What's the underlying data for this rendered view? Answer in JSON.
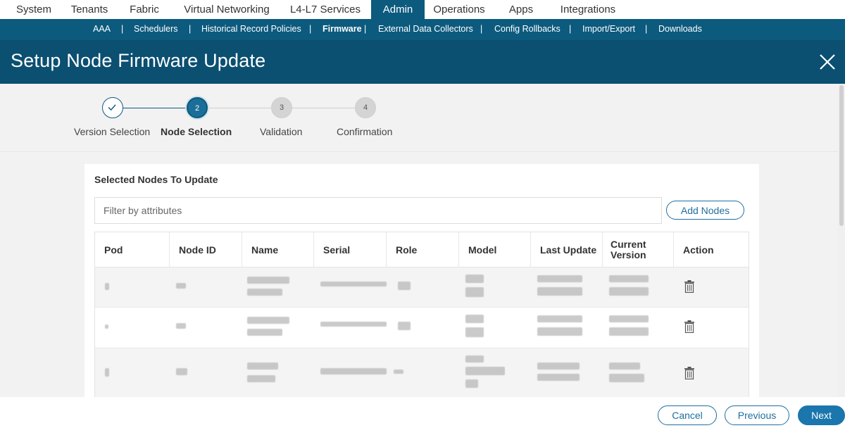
{
  "topnav": {
    "tabs": [
      {
        "label": "System"
      },
      {
        "label": "Tenants"
      },
      {
        "label": "Fabric"
      },
      {
        "label": "Virtual Networking"
      },
      {
        "label": "L4-L7 Services"
      },
      {
        "label": "Admin",
        "active": true
      },
      {
        "label": "Operations"
      },
      {
        "label": "Apps"
      },
      {
        "label": "Integrations"
      }
    ]
  },
  "subnav": {
    "items": [
      {
        "label": "AAA"
      },
      {
        "label": "Schedulers"
      },
      {
        "label": "Historical Record Policies"
      },
      {
        "label": "Firmware",
        "active": true
      },
      {
        "label": "External Data Collectors"
      },
      {
        "label": "Config Rollbacks"
      },
      {
        "label": "Import/Export"
      },
      {
        "label": "Downloads"
      }
    ],
    "separator": "|"
  },
  "header": {
    "title": "Setup Node Firmware Update",
    "close_icon": "close-icon"
  },
  "wizard": {
    "steps": [
      {
        "number": "",
        "label": "Version Selection",
        "state": "done",
        "icon": "check-icon"
      },
      {
        "number": "2",
        "label": "Node Selection",
        "state": "current"
      },
      {
        "number": "3",
        "label": "Validation",
        "state": "todo"
      },
      {
        "number": "4",
        "label": "Confirmation",
        "state": "todo"
      }
    ]
  },
  "main": {
    "section_title": "Selected Nodes To Update",
    "filter_placeholder": "Filter by attributes",
    "add_nodes_label": "Add Nodes",
    "table": {
      "columns": [
        "Pod",
        "Node ID",
        "Name",
        "Serial",
        "Role",
        "Model",
        "Last Update",
        "Current Version",
        "Action"
      ],
      "rows": [
        {
          "redacted": true,
          "action_icon": "trash-icon"
        },
        {
          "redacted": true,
          "action_icon": "trash-icon"
        },
        {
          "redacted": true,
          "action_icon": "trash-icon"
        }
      ]
    }
  },
  "footer": {
    "cancel_label": "Cancel",
    "previous_label": "Previous",
    "next_label": "Next"
  },
  "colors": {
    "nav_dark": "#0c5a7e",
    "header": "#0b4f71",
    "accent": "#1f6fa0",
    "primary_button": "#1a76ac"
  }
}
